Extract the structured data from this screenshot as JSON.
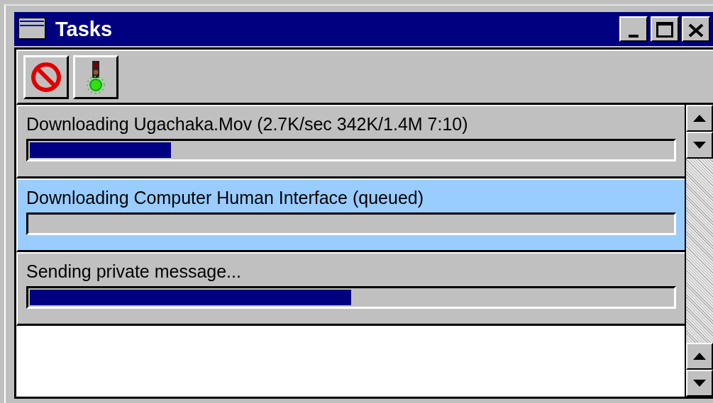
{
  "window": {
    "title": "Tasks"
  },
  "tasks": [
    {
      "label": "Downloading Ugachaka.Mov  (2.7K/sec 342K/1.4M 7:10)",
      "level": 0.22,
      "selected": false
    },
    {
      "label": "Downloading Computer Human Interface  (queued)",
      "selected": true
    },
    {
      "label": "Sending private message...",
      "level": 0.5,
      "selected": false
    }
  ]
}
